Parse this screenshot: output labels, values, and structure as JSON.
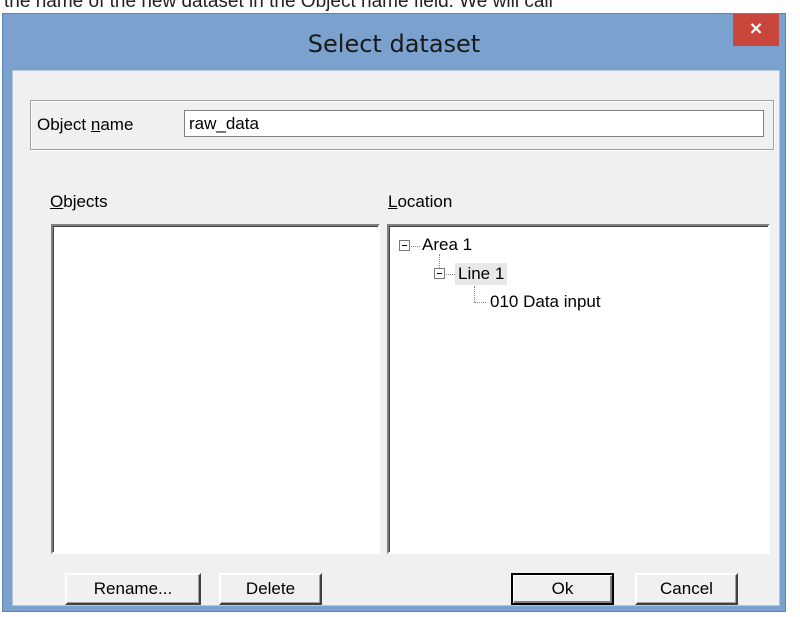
{
  "top_text": "the name of the new dataset in the Object name field. We will call",
  "dialog": {
    "title": "Select dataset",
    "close_glyph": "×"
  },
  "object_name": {
    "label_prefix": "Object ",
    "label_accel": "n",
    "label_suffix": "ame",
    "value": "raw_data"
  },
  "objects": {
    "label_accel": "O",
    "label_rest": "bjects",
    "items": []
  },
  "location": {
    "label_accel": "L",
    "label_rest": "ocation",
    "tree": [
      {
        "label": "Area 1",
        "expander": "minus"
      },
      {
        "label": "Line 1",
        "expander": "minus"
      },
      {
        "label": "010 Data input",
        "expander": "none"
      }
    ]
  },
  "buttons": {
    "rename": "Rename...",
    "delete": "Delete",
    "ok": "Ok",
    "cancel": "Cancel"
  }
}
